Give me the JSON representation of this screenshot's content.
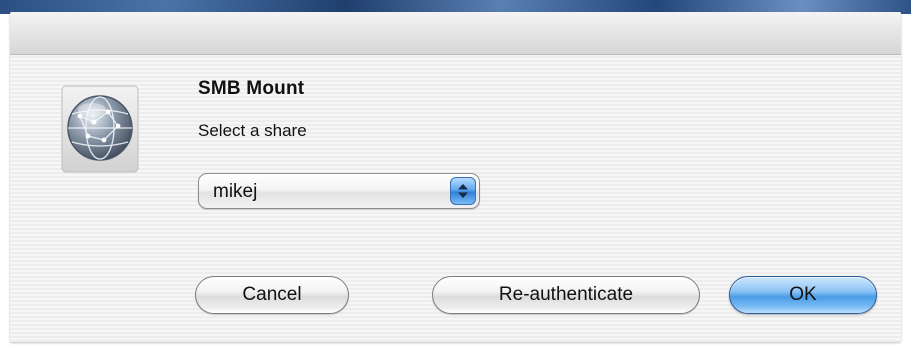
{
  "dialog": {
    "title": "SMB Mount",
    "prompt": "Select a share",
    "icon": "network-globe-icon"
  },
  "share_select": {
    "selected": "mikej"
  },
  "buttons": {
    "cancel_label": "Cancel",
    "reauth_label": "Re-authenticate",
    "ok_label": "OK"
  },
  "colors": {
    "default_button": "#4a9de8",
    "popup_arrows": "#2f7fd9"
  }
}
